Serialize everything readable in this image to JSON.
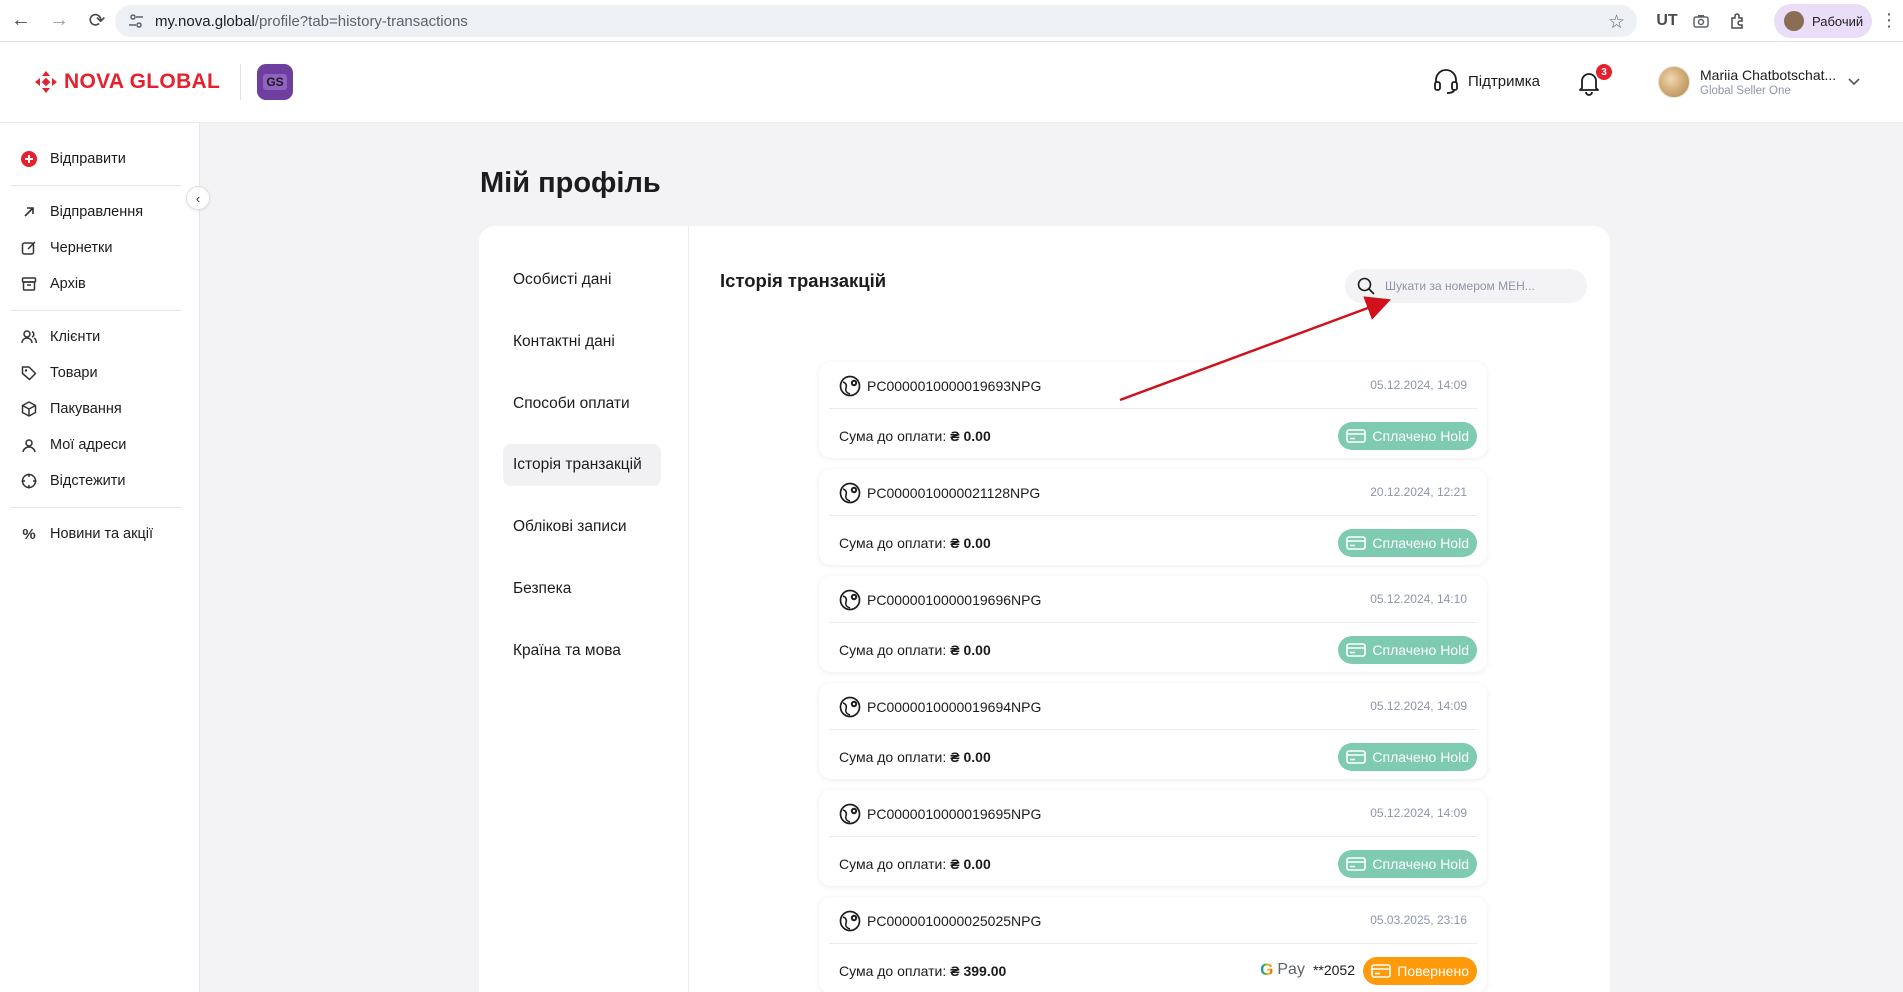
{
  "browser": {
    "url_host": "my.nova.global",
    "url_path": "/profile?tab=history-transactions",
    "profile_label": "Рабочий"
  },
  "header": {
    "brand": "NOVA GLOBAL",
    "badge": "GS",
    "support_label": "Підтримка",
    "notifications_count": "3",
    "user_name": "Mariia Chatbotschat...",
    "user_role": "Global Seller One"
  },
  "sidebar": {
    "items": [
      {
        "label": "Відправити"
      },
      {
        "label": "Відправлення"
      },
      {
        "label": "Чернетки"
      },
      {
        "label": "Архів"
      },
      {
        "label": "Клієнти"
      },
      {
        "label": "Товари"
      },
      {
        "label": "Пакування"
      },
      {
        "label": "Мої адреси"
      },
      {
        "label": "Відстежити"
      },
      {
        "label": "Новини та акції"
      }
    ]
  },
  "page": {
    "title": "Мій профіль",
    "tabs": [
      {
        "label": "Особисті дані"
      },
      {
        "label": "Контактні дані"
      },
      {
        "label": "Способи оплати"
      },
      {
        "label": "Історія транзакцій"
      },
      {
        "label": "Облікові записи"
      },
      {
        "label": "Безпека"
      },
      {
        "label": "Країна та мова"
      }
    ],
    "section_title": "Історія транзакцій",
    "search_placeholder": "Шукати за номером МЕН..."
  },
  "transactions": {
    "sum_label": "Сума до оплати:",
    "items": [
      {
        "id": "PC0000010000019693NPG",
        "date": "05.12.2024, 14:09",
        "sum": "₴ 0.00",
        "status": "Сплачено Hold"
      },
      {
        "id": "PC0000010000021128NPG",
        "date": "20.12.2024, 12:21",
        "sum": "₴ 0.00",
        "status": "Сплачено Hold"
      },
      {
        "id": "PC0000010000019696NPG",
        "date": "05.12.2024, 14:10",
        "sum": "₴ 0.00",
        "status": "Сплачено Hold"
      },
      {
        "id": "PC0000010000019694NPG",
        "date": "05.12.2024, 14:09",
        "sum": "₴ 0.00",
        "status": "Сплачено Hold"
      },
      {
        "id": "PC0000010000019695NPG",
        "date": "05.12.2024, 14:09",
        "sum": "₴ 0.00",
        "status": "Сплачено Hold"
      },
      {
        "id": "PC0000010000025025NPG",
        "date": "05.03.2025, 23:16",
        "sum": "₴ 399.00",
        "status": "Повернено",
        "pay_brand": "Pay",
        "pay_mask": "**2052"
      }
    ]
  },
  "colors": {
    "brand_red": "#e4222f",
    "hold_green": "#7ecbb2",
    "returned_orange": "#ff9b0a",
    "annotation_arrow": "#d0101a"
  }
}
